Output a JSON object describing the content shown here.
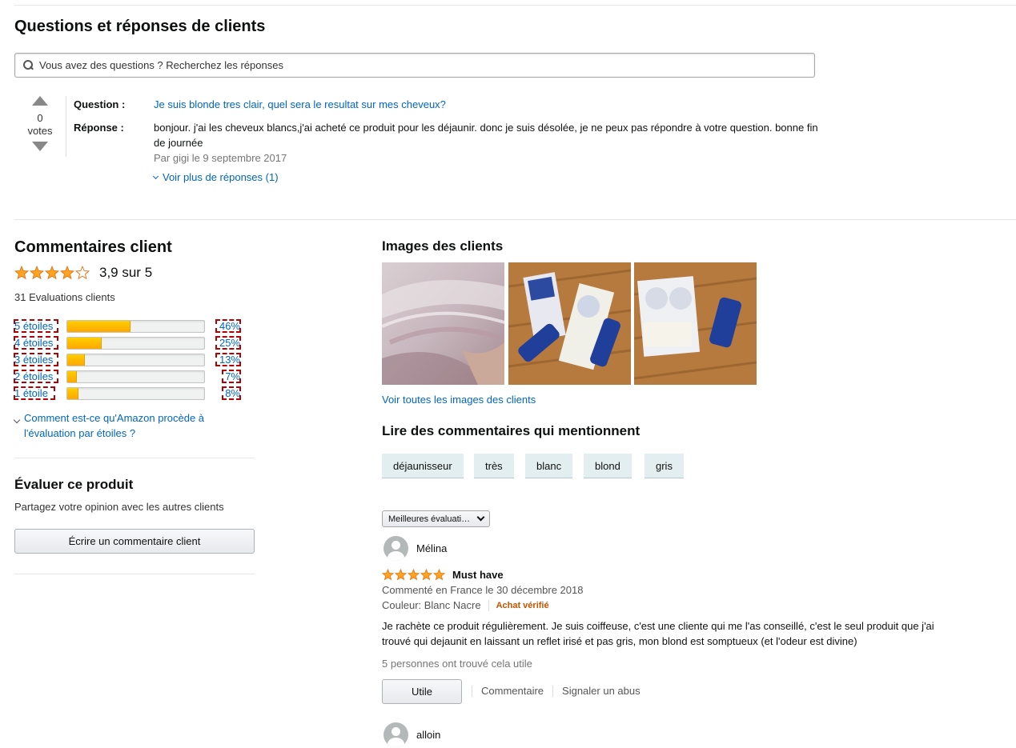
{
  "qa": {
    "title": "Questions et réponses de clients",
    "search_placeholder": "Vous avez des questions ? Recherchez les réponses",
    "votes_count": "0",
    "votes_label": "votes",
    "question_label": "Question :",
    "question_text": "Je suis blonde tres clair, quel sera le resultat sur mes cheveux?",
    "answer_label": "Réponse :",
    "answer_text": "bonjour. j'ai les cheveux blancs,j'ai acheté ce produit pour les déjaunir. donc je suis désolée, je ne peux pas répondre à votre question. bonne fin de journée",
    "answer_meta": "Par gigi le 9 septembre 2017",
    "more_answers": "Voir plus de réponses (1)"
  },
  "ratings": {
    "title": "Commentaires client",
    "average_text": "3,9 sur 5",
    "average_value": 3.9,
    "count_text": "31 Evaluations clients",
    "histogram": [
      {
        "label": "5 étoiles",
        "percent_text": "46%",
        "percent": 46
      },
      {
        "label": "4 étoiles",
        "percent_text": "25%",
        "percent": 25
      },
      {
        "label": "3 étoiles",
        "percent_text": "13%",
        "percent": 13
      },
      {
        "label": "2 étoiles",
        "percent_text": "7%",
        "percent": 7
      },
      {
        "label": "1 étoile",
        "percent_text": "8%",
        "percent": 8
      }
    ],
    "how_link": "Comment est-ce qu'Amazon procède à l'évaluation par étoiles ?",
    "evaluate_title": "Évaluer ce produit",
    "evaluate_sub": "Partagez votre opinion avec les autres clients",
    "write_button": "Écrire un commentaire client"
  },
  "customer_images": {
    "title": "Images des clients",
    "see_all": "Voir toutes les images des clients"
  },
  "mentions": {
    "title": "Lire des commentaires qui mentionnent",
    "tags": [
      "déjaunisseur",
      "très",
      "blanc",
      "blond",
      "gris"
    ]
  },
  "reviews": {
    "sort_value": "Meilleures évaluati…",
    "items": [
      {
        "name": "Mélina",
        "stars": 5,
        "title": "Must have",
        "date": "Commenté en France le 30 décembre 2018",
        "color": "Couleur: Blanc Nacre",
        "verified": "Achat vérifié",
        "body": "Je rachète ce produit régulièrement. Je suis coiffeuse, c'est une cliente qui me l'as conseillé, c'est le seul produit que j'ai trouvé qui dejaunit en laissant un reflet irisé et pas gris, mon blond est somptueux (et l'odeur est divine)",
        "helpful": "5 personnes ont trouvé cela utile",
        "useful_button": "Utile",
        "comment_link": "Commentaire",
        "report_link": "Signaler un abus"
      },
      {
        "name": "alloin"
      }
    ]
  },
  "colors": {
    "link": "#0066c0",
    "star": "#ffa41c",
    "verified": "#c45500",
    "bar_fill": "#ffa700"
  }
}
